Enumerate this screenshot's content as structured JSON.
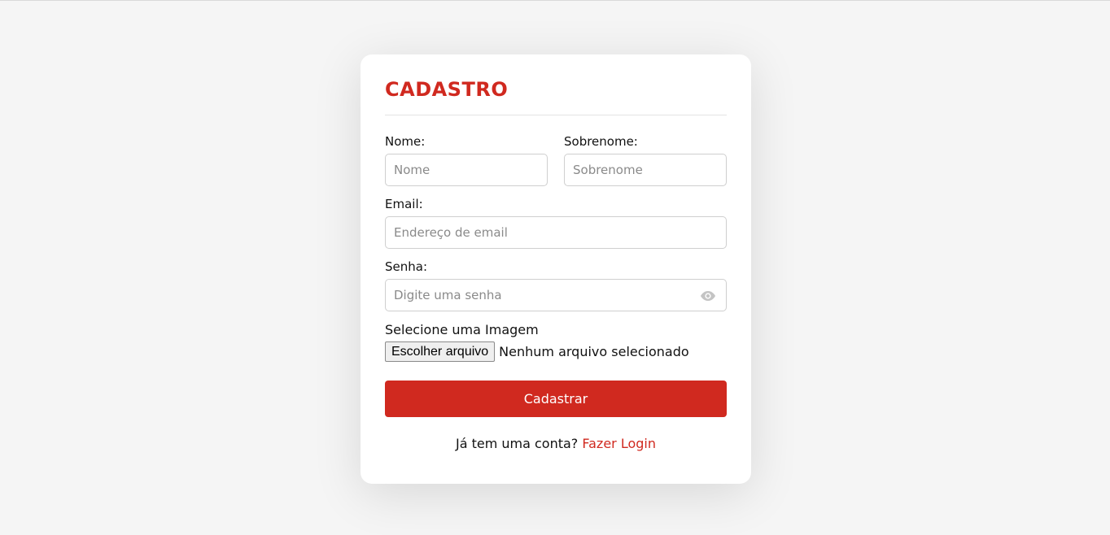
{
  "colors": {
    "accent": "#d0291f",
    "background": "#f5f5f5",
    "card": "#ffffff"
  },
  "form": {
    "title": "CADASTRO",
    "first_name": {
      "label": "Nome:",
      "placeholder": "Nome",
      "value": ""
    },
    "last_name": {
      "label": "Sobrenome:",
      "placeholder": "Sobrenome",
      "value": ""
    },
    "email": {
      "label": "Email:",
      "placeholder": "Endereço de email",
      "value": ""
    },
    "password": {
      "label": "Senha:",
      "placeholder": "Digite uma senha",
      "value": "",
      "toggle_icon": "eye-icon"
    },
    "image": {
      "label": "Selecione uma Imagem",
      "button_label": "Escolher arquivo",
      "status": "Nenhum arquivo selecionado"
    },
    "submit_label": "Cadastrar",
    "footer": {
      "question": "Já tem uma conta?",
      "link_label": "Fazer Login"
    }
  }
}
